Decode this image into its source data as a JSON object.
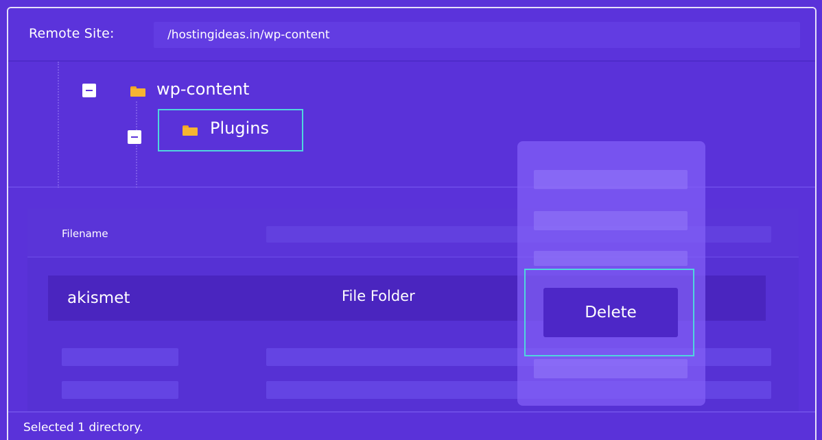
{
  "remote_site": {
    "label": "Remote Site:",
    "path": "/hostingideas.in/wp-content"
  },
  "tree": {
    "nodes": [
      {
        "label": "wp-content",
        "icon": "folder-icon",
        "expanded": true
      },
      {
        "label": "Plugins",
        "icon": "folder-icon",
        "expanded": true,
        "selected": true
      }
    ]
  },
  "file_list": {
    "columns": [
      "Filename"
    ],
    "rows": [
      {
        "name": "akismet",
        "type": "File Folder",
        "selected": true
      }
    ]
  },
  "context_menu": {
    "delete_label": "Delete"
  },
  "status_bar": {
    "text": "Selected 1 directory."
  },
  "colors": {
    "background": "#5a32d9",
    "highlight_outline": "#4fd6dd",
    "folder": "#f7b431",
    "selected_row": "#4a25bf"
  }
}
